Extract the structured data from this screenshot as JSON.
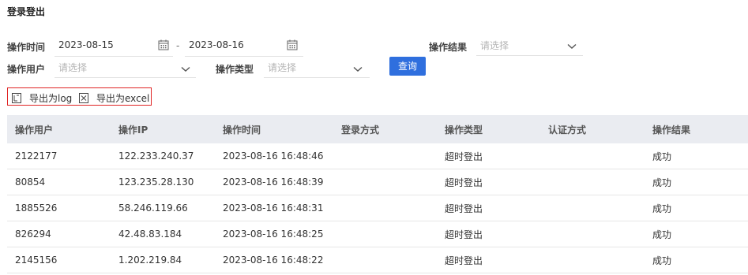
{
  "page": {
    "title": "登录登出"
  },
  "filters": {
    "op_time_label": "操作时间",
    "date_start": "2023-08-15",
    "date_sep": "-",
    "date_end": "2023-08-16",
    "op_result_label": "操作结果",
    "op_result_placeholder": "请选择",
    "op_user_label": "操作用户",
    "op_user_placeholder": "请选择",
    "op_type_label": "操作类型",
    "op_type_placeholder": "请选择",
    "query_label": "查询"
  },
  "export": {
    "log_label": "导出为log",
    "excel_label": "导出为excel"
  },
  "table": {
    "headers": [
      "操作用户",
      "操作IP",
      "操作时间",
      "登录方式",
      "操作类型",
      "认证方式",
      "操作结果"
    ],
    "rows": [
      [
        "2122177",
        "122.233.240.37",
        "2023-08-16 16:48:46",
        "",
        "超时登出",
        "",
        "成功"
      ],
      [
        "80854",
        "123.235.28.130",
        "2023-08-16 16:48:39",
        "",
        "超时登出",
        "",
        "成功"
      ],
      [
        "1885526",
        "58.246.119.66",
        "2023-08-16 16:48:31",
        "",
        "超时登出",
        "",
        "成功"
      ],
      [
        "826294",
        "42.48.83.184",
        "2023-08-16 16:48:25",
        "",
        "超时登出",
        "",
        "成功"
      ],
      [
        "2145156",
        "1.202.219.84",
        "2023-08-16 16:48:22",
        "",
        "超时登出",
        "",
        "成功"
      ]
    ]
  },
  "colors": {
    "primary": "#2f6fde",
    "export_border": "#e02424",
    "header_bg": "#eaecf1"
  },
  "icons": [
    "calendar-icon",
    "chevron-down-icon",
    "log-file-icon",
    "excel-file-icon"
  ]
}
